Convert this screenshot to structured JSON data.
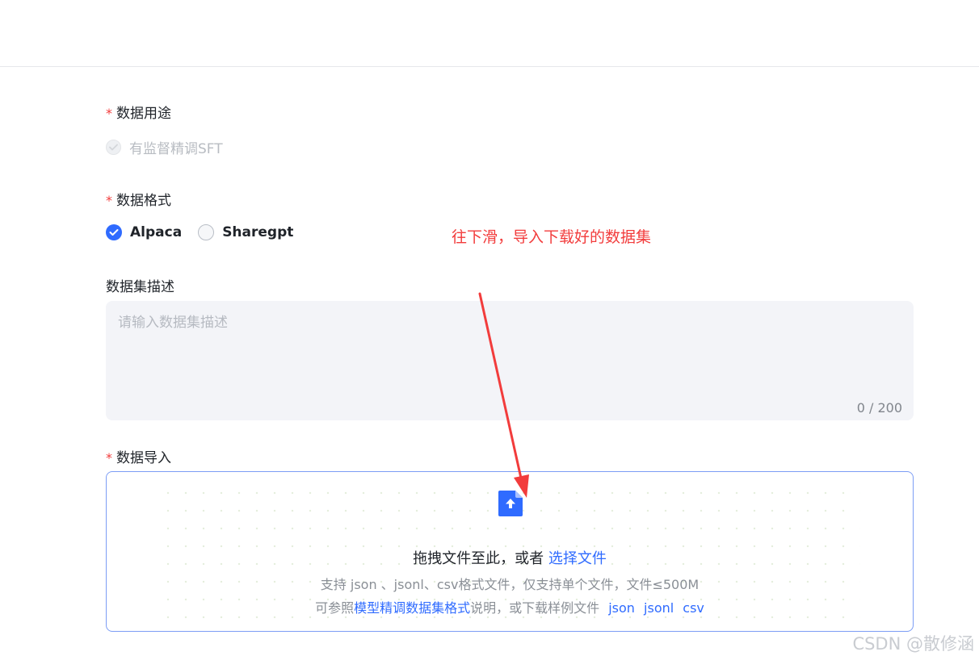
{
  "usage": {
    "label": "数据用途",
    "option": "有监督精调SFT"
  },
  "format": {
    "label": "数据格式",
    "options": [
      "Alpaca",
      "Sharegpt"
    ],
    "selected": "Alpaca"
  },
  "annotation": {
    "text": "往下滑，导入下载好的数据集",
    "color": "#f23c3c"
  },
  "description": {
    "label": "数据集描述",
    "placeholder": "请输入数据集描述",
    "value": "",
    "counter": "0 / 200"
  },
  "import": {
    "label": "数据导入",
    "drop_text": "拖拽文件至此，或者",
    "choose_file": "选择文件",
    "hint_line1": "支持 json 、jsonl、csv格式文件，仅支持单个文件，文件≤500M",
    "hint2_prefix": "可参照",
    "hint2_link": "模型精调数据集格式",
    "hint2_suffix": "说明，或下载样例文件",
    "sample_links": [
      "json",
      "jsonl",
      "csv"
    ],
    "upload_icon": "upload-file-icon"
  },
  "watermark": "CSDN @散修涵",
  "colors": {
    "accent": "#2f6bff",
    "required": "#f23c3c"
  }
}
